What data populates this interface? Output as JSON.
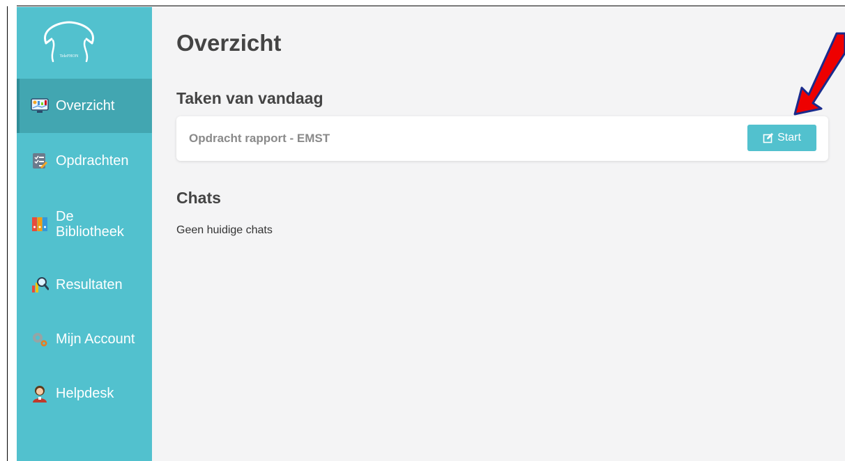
{
  "colors": {
    "sidebar": "#52c1ce",
    "sidebar_active": "#42a6b1",
    "accent": "#52c1ce",
    "arrow": "#e00000"
  },
  "logo": {
    "text": "TeleFHON",
    "icon": "phone-handset-logo"
  },
  "sidebar": {
    "items": [
      {
        "label": "Overzicht",
        "icon": "dashboard-icon",
        "active": true
      },
      {
        "label": "Opdrachten",
        "icon": "checklist-icon",
        "active": false
      },
      {
        "label": "De Bibliotheek",
        "icon": "binders-icon",
        "active": false
      },
      {
        "label": "Resultaten",
        "icon": "chart-magnifier-icon",
        "active": false
      },
      {
        "label": "Mijn Account",
        "icon": "gears-icon",
        "active": false
      },
      {
        "label": "Helpdesk",
        "icon": "support-agent-icon",
        "active": false
      }
    ]
  },
  "main": {
    "title": "Overzicht",
    "tasks_heading": "Taken van vandaag",
    "tasks": [
      {
        "title": "Opdracht rapport - EMST",
        "button_label": "Start",
        "button_icon": "edit-icon"
      }
    ],
    "chats_heading": "Chats",
    "chats_empty": "Geen huidige chats"
  }
}
